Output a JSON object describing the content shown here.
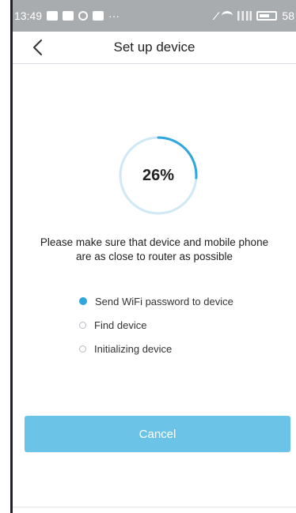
{
  "status_bar": {
    "time": "13:49",
    "ellipsis": "···",
    "battery_level": "58"
  },
  "header": {
    "title": "Set up device"
  },
  "progress": {
    "percent_label": "26%",
    "value_fraction": 0.26
  },
  "instruction": {
    "line1": "Please make sure that device and mobile phone",
    "line2": "are as close to router as possible"
  },
  "steps": [
    {
      "label": "Send WiFi password to device",
      "active": true
    },
    {
      "label": "Find device",
      "active": false
    },
    {
      "label": "Initializing device",
      "active": false
    }
  ],
  "actions": {
    "cancel_label": "Cancel"
  },
  "colors": {
    "accent": "#2fa6de",
    "track": "#cfe8f5",
    "button": "#6cc3e8"
  },
  "icons": {
    "back": "chevron-left-icon",
    "active_step": "radio-filled-icon",
    "inactive_step": "radio-empty-icon"
  }
}
